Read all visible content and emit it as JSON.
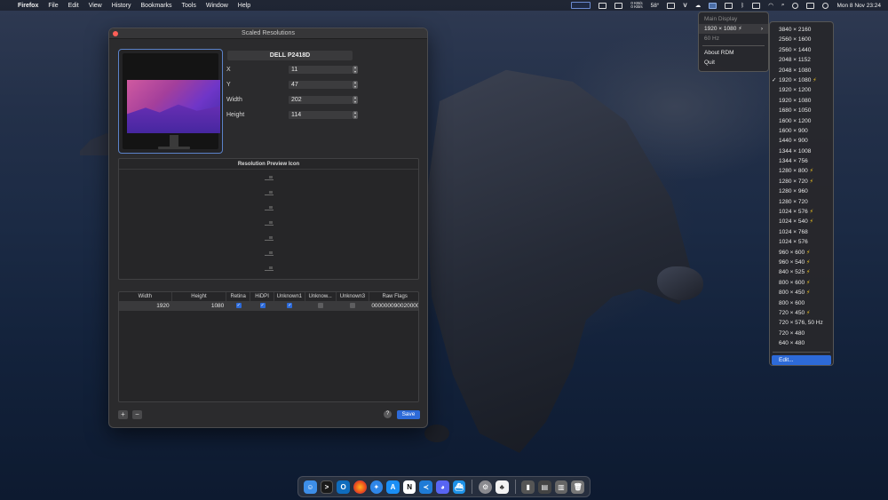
{
  "menubar": {
    "app_name": "Firefox",
    "items": [
      "File",
      "Edit",
      "View",
      "History",
      "Bookmarks",
      "Tools",
      "Window",
      "Help"
    ],
    "net_up": "0 KB/s",
    "net_down": "0 KB/s",
    "temperature": "58°",
    "datetime": "Mon 8 Nov  23:24"
  },
  "window": {
    "title": "Scaled Resolutions",
    "display_name": "DELL P2418D",
    "fields": [
      {
        "label": "X",
        "value": "11"
      },
      {
        "label": "Y",
        "value": "47"
      },
      {
        "label": "Width",
        "value": "202"
      },
      {
        "label": "Height",
        "value": "114"
      }
    ],
    "preview_icon_title": "Resolution Preview Icon",
    "table": {
      "columns": [
        "Width",
        "Height",
        "Retina",
        "HiDPI",
        "Unknown1",
        "Unknow...",
        "Unknown3",
        "Raw Flags"
      ],
      "rows": [
        {
          "width": "1920",
          "height": "1080",
          "retina": true,
          "hidpi": true,
          "unknown1": true,
          "unknown2": false,
          "unknown3": false,
          "raw_flags": "0000000900200000"
        }
      ]
    },
    "add_label": "+",
    "remove_label": "−",
    "help_label": "?",
    "save_label": "Save"
  },
  "menu_main": {
    "header": "Main Display",
    "current": "1920 × 1080 ⚡",
    "refresh": "60 Hz",
    "about": "About RDM",
    "quit": "Quit"
  },
  "resolutions": [
    "3840 × 2160",
    "2560 × 1600",
    "2560 × 1440",
    "2048 × 1152",
    "2048 × 1080",
    "1920 × 1080",
    "1920 × 1200",
    "1920 × 1080",
    "1680 × 1050",
    "1600 × 1200",
    "1600 × 900",
    "1440 × 900",
    "1344 × 1008",
    "1344 × 756",
    "1280 × 800",
    "1280 × 720",
    "1280 × 960",
    "1280 × 720",
    "1024 × 576",
    "1024 × 540",
    "1024 × 768",
    "1024 × 576",
    "960 × 600",
    "960 × 540",
    "840 × 525",
    "800 × 600",
    "800 × 450",
    "800 × 600",
    "720 × 450",
    "720 × 576, 50 Hz",
    "720 × 480",
    "640 × 480"
  ],
  "resolution_bolts": [
    5,
    14,
    15,
    18,
    19,
    22,
    23,
    24,
    25,
    26,
    28
  ],
  "resolution_checked": 5,
  "edit_label": "Edit...",
  "dock": {
    "apps": [
      "finder-icon",
      "terminal-icon",
      "outlook-icon",
      "firefox-icon",
      "safari-icon",
      "app-store-icon",
      "notion-icon",
      "vscode-icon",
      "discord-icon",
      "docker-icon",
      "system-preferences-icon",
      "activity-icon",
      "downloads-icon",
      "documents-icon",
      "trash-icon"
    ]
  }
}
